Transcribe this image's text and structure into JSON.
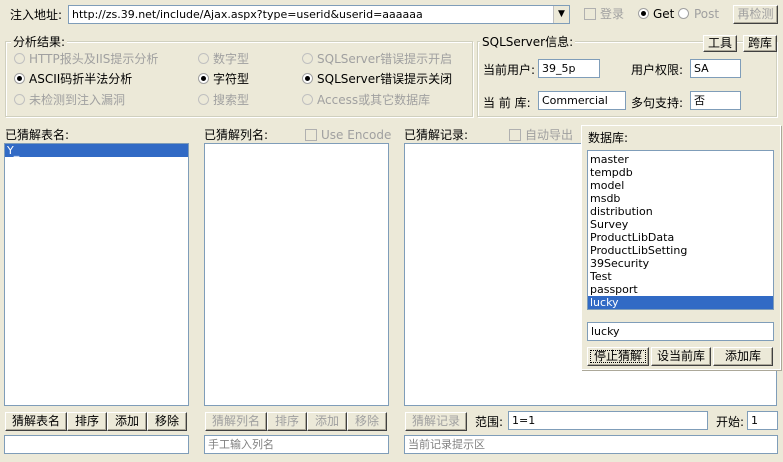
{
  "url_bar": {
    "label": "注入地址:",
    "url": "http://zs.39.net/include/Ajax.aspx?type=userid&userid=aaaaaa",
    "login_label": "登录",
    "get_label": "Get",
    "post_label": "Post",
    "recheck_label": "再检测"
  },
  "analysis": {
    "legend": "分析结果:",
    "opt_http": "HTTP报头及IIS提示分析",
    "opt_ascii": "ASCII码折半法分析",
    "opt_notfound": "未检测到注入漏洞",
    "opt_numeric": "数字型",
    "opt_char": "字符型",
    "opt_search": "搜索型",
    "opt_sqlerr_on": "SQLServer错误提示开启",
    "opt_sqlerr_off": "SQLServer错误提示关闭",
    "opt_access": "Access或其它数据库"
  },
  "sqlserver": {
    "legend": "SQLServer信息:",
    "tools_label": "工具",
    "crossdb_label": "跨库",
    "user_label": "当前用户:",
    "user_value": "39_5p",
    "perm_label": "用户权限:",
    "perm_value": "SA",
    "db_label": "当 前 库:",
    "db_value": "Commercial",
    "multi_label": "多句支持:",
    "multi_value": "否"
  },
  "tables": {
    "label": "已猜解表名:",
    "items": [
      "Y_"
    ],
    "btn_guess": "猜解表名",
    "btn_sort": "排序",
    "btn_add": "添加",
    "btn_remove": "移除"
  },
  "columns": {
    "label": "已猜解列名:",
    "use_encode": "Use Encode",
    "btn_guess": "猜解列名",
    "btn_sort": "排序",
    "btn_add": "添加",
    "btn_remove": "移除",
    "manual_placeholder": "手工输入列名"
  },
  "records": {
    "label": "已猜解记录:",
    "auto_export": "自动导出",
    "btn_guess": "猜解记录",
    "range_label": "范围:",
    "range_value": "1=1",
    "start_label": "开始:",
    "start_value": "1",
    "hint": "当前记录提示区"
  },
  "database": {
    "label": "数据库:",
    "items": [
      "master",
      "tempdb",
      "model",
      "msdb",
      "distribution",
      "Survey",
      "ProductLibData",
      "ProductLibSetting",
      "39Security",
      "Test",
      "passport",
      "lucky"
    ],
    "selected": "lucky",
    "input_value": "lucky",
    "btn_stop": "停止猜解",
    "btn_setcurrent": "设当前库",
    "btn_adddb": "添加库"
  },
  "colors": {
    "face": "#ece9d8",
    "selection": "#316ac5",
    "border": "#7f9db9"
  }
}
